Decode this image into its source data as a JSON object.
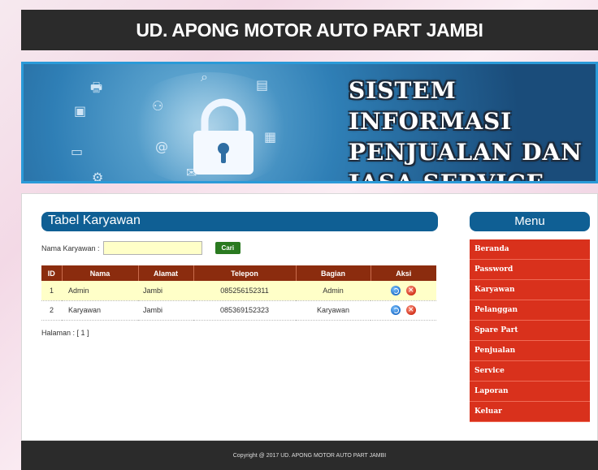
{
  "header": {
    "title": "UD. APONG MOTOR AUTO PART JAMBI"
  },
  "banner": {
    "line1": "SISTEM INFORMASI",
    "line2": "PENJUALAN DAN",
    "line3": "JASA SERVICE",
    "icons": [
      "printer-icon",
      "lock-icon",
      "gear-icon",
      "at-icon",
      "mail-icon",
      "cart-icon",
      "image-icon"
    ]
  },
  "main": {
    "title": "Tabel Karyawan",
    "search_label": "Nama Karyawan :",
    "search_value": "",
    "search_button": "Cari",
    "columns": [
      "ID",
      "Nama",
      "Alamat",
      "Telepon",
      "Bagian",
      "Aksi"
    ],
    "rows": [
      {
        "id": "1",
        "nama": "Admin",
        "alamat": "Jambi",
        "telepon": "085256152311",
        "bagian": "Admin"
      },
      {
        "id": "2",
        "nama": "Karyawan",
        "alamat": "Jambi",
        "telepon": "085369152323",
        "bagian": "Karyawan"
      }
    ],
    "pagination": "Halaman : [ 1 ]"
  },
  "sidebar": {
    "title": "Menu",
    "items": [
      "Beranda",
      "Password",
      "Karyawan",
      "Pelanggan",
      "Spare Part",
      "Penjualan",
      "Service",
      "Laporan",
      "Keluar"
    ]
  },
  "footer": {
    "text": "Copyright @ 2017 UD. APONG MOTOR AUTO PART JAMBI"
  },
  "colors": {
    "header_bg": "#2b2b2b",
    "panel_title_bg": "#0f5f94",
    "table_header_bg": "#8b2c0e",
    "highlight_row": "#ffffc8",
    "menu_item_bg": "#d9311c",
    "cari_button": "#2a7a20"
  }
}
